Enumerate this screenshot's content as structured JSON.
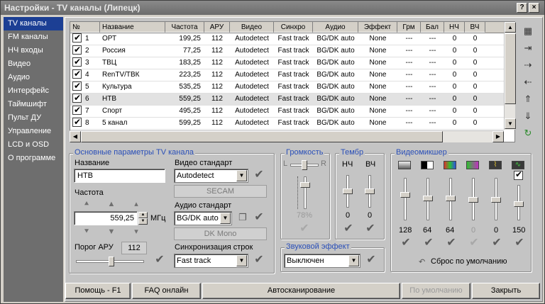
{
  "window": {
    "title": "Настройки - TV каналы (Липецк)",
    "buttons": [
      "?",
      "×"
    ]
  },
  "sidebar": {
    "items": [
      {
        "label": "TV каналы",
        "active": true
      },
      {
        "label": "FM каналы"
      },
      {
        "label": "НЧ входы"
      },
      {
        "label": "Видео"
      },
      {
        "label": "Аудио"
      },
      {
        "label": "Интерфейс"
      },
      {
        "label": "Таймшифт"
      },
      {
        "label": "Пульт ДУ"
      },
      {
        "label": "Управление"
      },
      {
        "label": "LCD и OSD"
      },
      {
        "label": "О программе"
      }
    ]
  },
  "table": {
    "headers": [
      "№",
      "Название",
      "Частота",
      "АРУ",
      "Видео",
      "Синхро",
      "Аудио",
      "Эффект",
      "Грм",
      "Бал",
      "НЧ",
      "ВЧ"
    ],
    "rows": [
      [
        "1",
        "ОРТ",
        "199,25",
        "112",
        "Autodetect",
        "Fast track",
        "BG/DK auto",
        "None",
        "---",
        "---",
        "0",
        "0"
      ],
      [
        "2",
        "Россия",
        "77,25",
        "112",
        "Autodetect",
        "Fast track",
        "BG/DK auto",
        "None",
        "---",
        "---",
        "0",
        "0"
      ],
      [
        "3",
        "ТВЦ",
        "183,25",
        "112",
        "Autodetect",
        "Fast track",
        "BG/DK auto",
        "None",
        "---",
        "---",
        "0",
        "0"
      ],
      [
        "4",
        "RenTV/ТВК",
        "223,25",
        "112",
        "Autodetect",
        "Fast track",
        "BG/DK auto",
        "None",
        "---",
        "---",
        "0",
        "0"
      ],
      [
        "5",
        "Культура",
        "535,25",
        "112",
        "Autodetect",
        "Fast track",
        "BG/DK auto",
        "None",
        "---",
        "---",
        "0",
        "0"
      ],
      [
        "6",
        "НТВ",
        "559,25",
        "112",
        "Autodetect",
        "Fast track",
        "BG/DK auto",
        "None",
        "---",
        "---",
        "0",
        "0"
      ],
      [
        "7",
        "Спорт",
        "495,25",
        "112",
        "Autodetect",
        "Fast track",
        "BG/DK auto",
        "None",
        "---",
        "---",
        "0",
        "0"
      ],
      [
        "8",
        "5 канал",
        "599,25",
        "112",
        "Autodetect",
        "Fast track",
        "BG/DK auto",
        "None",
        "---",
        "---",
        "0",
        "0"
      ]
    ],
    "selected_row": 6
  },
  "tools": {
    "icons": [
      "list-icon",
      "insert-icon",
      "import-icon",
      "export-icon",
      "move-up-icon",
      "move-down-icon",
      "refresh-icon"
    ]
  },
  "main_params": {
    "title": "Основные параметры TV канала",
    "name_label": "Название",
    "name_value": "НТВ",
    "freq_label": "Частота",
    "freq_value": "559,25",
    "freq_unit": "МГц",
    "agc_label": "Порог АРУ",
    "agc_value": "112",
    "video_std_label": "Видео стандарт",
    "video_std_value": "Autodetect",
    "video_std_status": "SECAM",
    "audio_std_label": "Аудио стандарт",
    "audio_std_value": "BG/DK auto",
    "audio_std_status": "DK Mono",
    "sync_label": "Синхронизация строк",
    "sync_value": "Fast track"
  },
  "volume": {
    "title": "Громкость",
    "left": "L",
    "right": "R",
    "percent": "78%",
    "level": 0.78
  },
  "timbre": {
    "title": "Тембр",
    "low_label": "НЧ",
    "high_label": "ВЧ",
    "low_value": "0",
    "high_value": "0"
  },
  "sound_effect": {
    "title": "Звуковой эффект",
    "value": "Выключен"
  },
  "videomixer": {
    "title": "Видеомикшер",
    "values": [
      "128",
      "64",
      "64",
      "0",
      "0",
      "150"
    ],
    "reset_label": "Сброс по умолчанию"
  },
  "bottom": {
    "help": "Помощь - F1",
    "faq": "FAQ онлайн",
    "autoscan": "Автосканирование",
    "defaults": "По умолчанию",
    "close": "Закрыть"
  }
}
